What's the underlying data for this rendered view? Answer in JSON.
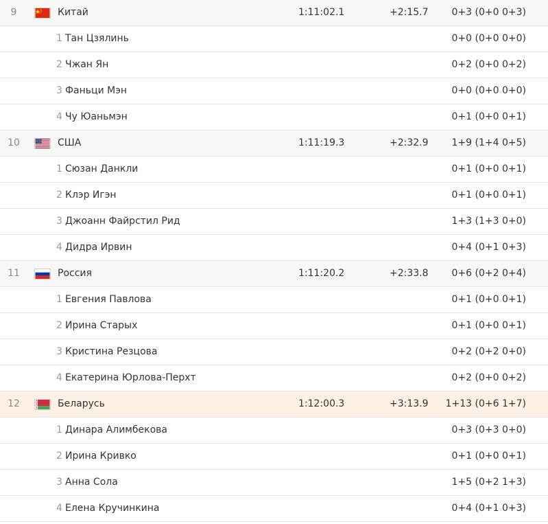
{
  "teams": [
    {
      "rank": "9",
      "country": "Китай",
      "flag": "china-flag-icon",
      "time": "1:11:02.1",
      "gap": "+2:15.7",
      "penalties": "0+3 (0+0 0+3)",
      "highlight": false,
      "athletes": [
        {
          "num": "1",
          "name": "Тан Цзялинь",
          "penalties": "0+0 (0+0 0+0)"
        },
        {
          "num": "2",
          "name": "Чжан Ян",
          "penalties": "0+2 (0+0 0+2)"
        },
        {
          "num": "3",
          "name": "Фаньци Мэн",
          "penalties": "0+0 (0+0 0+0)"
        },
        {
          "num": "4",
          "name": "Чу Юаньмэн",
          "penalties": "0+1 (0+0 0+1)"
        }
      ]
    },
    {
      "rank": "10",
      "country": "США",
      "flag": "usa-flag-icon",
      "time": "1:11:19.3",
      "gap": "+2:32.9",
      "penalties": "1+9 (1+4 0+5)",
      "highlight": false,
      "athletes": [
        {
          "num": "1",
          "name": "Сюзан Данкли",
          "penalties": "0+1 (0+0 0+1)"
        },
        {
          "num": "2",
          "name": "Клэр Игэн",
          "penalties": "0+1 (0+0 0+1)"
        },
        {
          "num": "3",
          "name": "Джоанн Файрстил Рид",
          "penalties": "1+3 (1+3 0+0)"
        },
        {
          "num": "4",
          "name": "Дидра Ирвин",
          "penalties": "0+4 (0+1 0+3)"
        }
      ]
    },
    {
      "rank": "11",
      "country": "Россия",
      "flag": "russia-flag-icon",
      "time": "1:11:20.2",
      "gap": "+2:33.8",
      "penalties": "0+6 (0+2 0+4)",
      "highlight": false,
      "athletes": [
        {
          "num": "1",
          "name": "Евгения Павлова",
          "penalties": "0+1 (0+0 0+1)"
        },
        {
          "num": "2",
          "name": "Ирина Старых",
          "penalties": "0+1 (0+0 0+1)"
        },
        {
          "num": "3",
          "name": "Кристина Резцова",
          "penalties": "0+2 (0+2 0+0)"
        },
        {
          "num": "4",
          "name": "Екатерина Юрлова-Перхт",
          "penalties": "0+2 (0+0 0+2)"
        }
      ]
    },
    {
      "rank": "12",
      "country": "Беларусь",
      "flag": "belarus-flag-icon",
      "time": "1:12:00.3",
      "gap": "+3:13.9",
      "penalties": "1+13 (0+6 1+7)",
      "highlight": true,
      "athletes": [
        {
          "num": "1",
          "name": "Динара Алимбекова",
          "penalties": "0+3 (0+3 0+0)"
        },
        {
          "num": "2",
          "name": "Ирина Кривко",
          "penalties": "0+1 (0+0 0+1)"
        },
        {
          "num": "3",
          "name": "Анна Сола",
          "penalties": "1+5 (0+2 1+3)"
        },
        {
          "num": "4",
          "name": "Елена Кручинкина",
          "penalties": "0+4 (0+1 0+3)"
        }
      ]
    }
  ],
  "colors": {
    "row_divider": "#e6e6e6",
    "team_row_bg": "#f7f7f7",
    "highlight_row_bg": "#fdf0e4",
    "muted_text": "#999999",
    "main_text": "#333333"
  }
}
